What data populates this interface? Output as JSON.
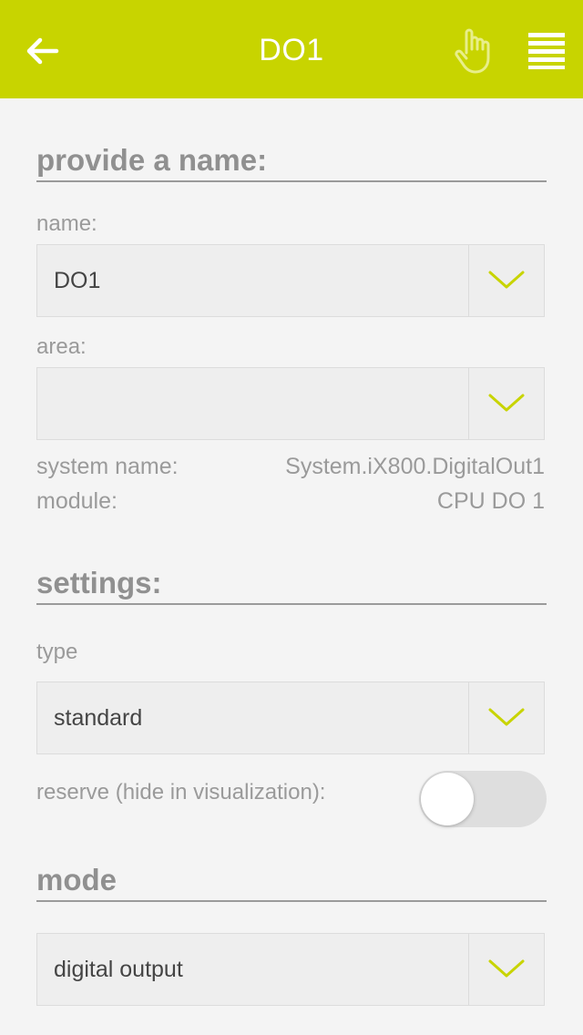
{
  "header": {
    "title": "DO1",
    "back_icon": "arrow-left-icon",
    "hand_icon": "hand-pointer-icon",
    "menu_icon": "hamburger-menu-icon",
    "background_color": "#c8d400"
  },
  "name_section": {
    "title": "provide a name:",
    "name_label": "name:",
    "name_value": "DO1",
    "area_label": "area:",
    "area_value": "",
    "system_name_label": "system name:",
    "system_name_value": "System.iX800.DigitalOut1",
    "module_label": "module:",
    "module_value": "CPU DO 1"
  },
  "settings_section": {
    "title": "settings:",
    "type_label": "type",
    "type_value": "standard",
    "reserve_label": "reserve (hide in visualization):",
    "reserve_on": false
  },
  "mode_section": {
    "title": "mode",
    "mode_value": "digital output"
  },
  "accent_color": "#c8d400"
}
